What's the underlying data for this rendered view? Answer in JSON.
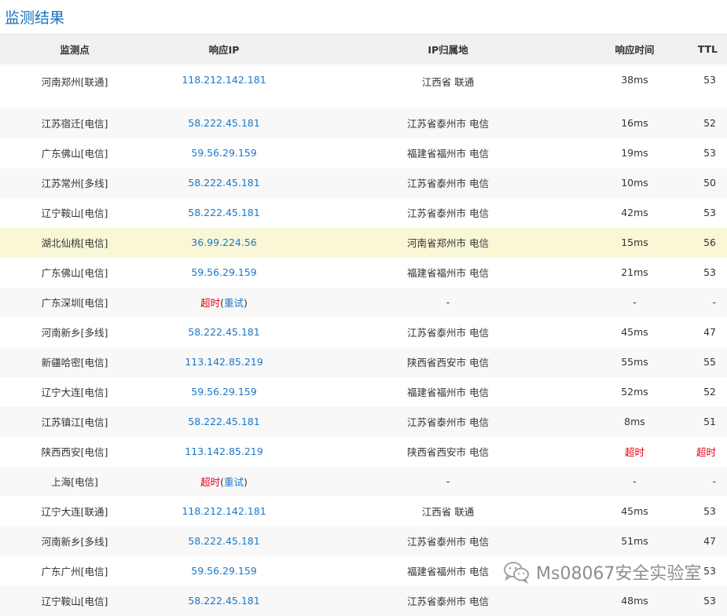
{
  "page_title": "监测结果",
  "columns": {
    "node": "监测点",
    "ip": "响应IP",
    "location": "IP归属地",
    "time": "响应时间",
    "ttl": "TTL"
  },
  "rows": [
    {
      "node": "河南郑州[联通]",
      "ip": "118.212.142.181",
      "location": "江西省 联通",
      "time": "38ms",
      "ttl": "53"
    },
    {
      "node": "江苏宿迁[电信]",
      "ip": "58.222.45.181",
      "location": "江苏省泰州市 电信",
      "time": "16ms",
      "ttl": "52"
    },
    {
      "node": "广东佛山[电信]",
      "ip": "59.56.29.159",
      "location": "福建省福州市 电信",
      "time": "19ms",
      "ttl": "53"
    },
    {
      "node": "江苏常州[多线]",
      "ip": "58.222.45.181",
      "location": "江苏省泰州市 电信",
      "time": "10ms",
      "ttl": "50"
    },
    {
      "node": "辽宁鞍山[电信]",
      "ip": "58.222.45.181",
      "location": "江苏省泰州市 电信",
      "time": "42ms",
      "ttl": "53"
    },
    {
      "node": "湖北仙桃[电信]",
      "ip": "36.99.224.56",
      "location": "河南省郑州市 电信",
      "time": "15ms",
      "ttl": "56"
    },
    {
      "node": "广东佛山[电信]",
      "ip": "59.56.29.159",
      "location": "福建省福州市 电信",
      "time": "21ms",
      "ttl": "53"
    },
    {
      "node": "广东深圳[电信]",
      "ip_timeout": "超时",
      "retry": "重试",
      "location": "-",
      "time": "-",
      "ttl": "-"
    },
    {
      "node": "河南新乡[多线]",
      "ip": "58.222.45.181",
      "location": "江苏省泰州市 电信",
      "time": "45ms",
      "ttl": "47"
    },
    {
      "node": "新疆哈密[电信]",
      "ip": "113.142.85.219",
      "location": "陕西省西安市 电信",
      "time": "55ms",
      "ttl": "55"
    },
    {
      "node": "辽宁大连[电信]",
      "ip": "59.56.29.159",
      "location": "福建省福州市 电信",
      "time": "52ms",
      "ttl": "52"
    },
    {
      "node": "江苏镇江[电信]",
      "ip": "58.222.45.181",
      "location": "江苏省泰州市 电信",
      "time": "8ms",
      "ttl": "51"
    },
    {
      "node": "陕西西安[电信]",
      "ip": "113.142.85.219",
      "location": "陕西省西安市 电信",
      "time": "超时",
      "ttl": "超时"
    },
    {
      "node": "上海[电信]",
      "ip_timeout": "超时",
      "retry": "重试",
      "location": "-",
      "time": "-",
      "ttl": "-"
    },
    {
      "node": "辽宁大连[联通]",
      "ip": "118.212.142.181",
      "location": "江西省 联通",
      "time": "45ms",
      "ttl": "53"
    },
    {
      "node": "河南新乡[多线]",
      "ip": "58.222.45.181",
      "location": "江苏省泰州市 电信",
      "time": "51ms",
      "ttl": "47"
    },
    {
      "node": "广东广州[电信]",
      "ip": "59.56.29.159",
      "location": "福建省福州市 电信",
      "time": "",
      "ttl": "53"
    },
    {
      "node": "辽宁鞍山[电信]",
      "ip": "58.222.45.181",
      "location": "江苏省泰州市 电信",
      "time": "48ms",
      "ttl": "53"
    }
  ],
  "watermark": "Ms08067安全实验室"
}
